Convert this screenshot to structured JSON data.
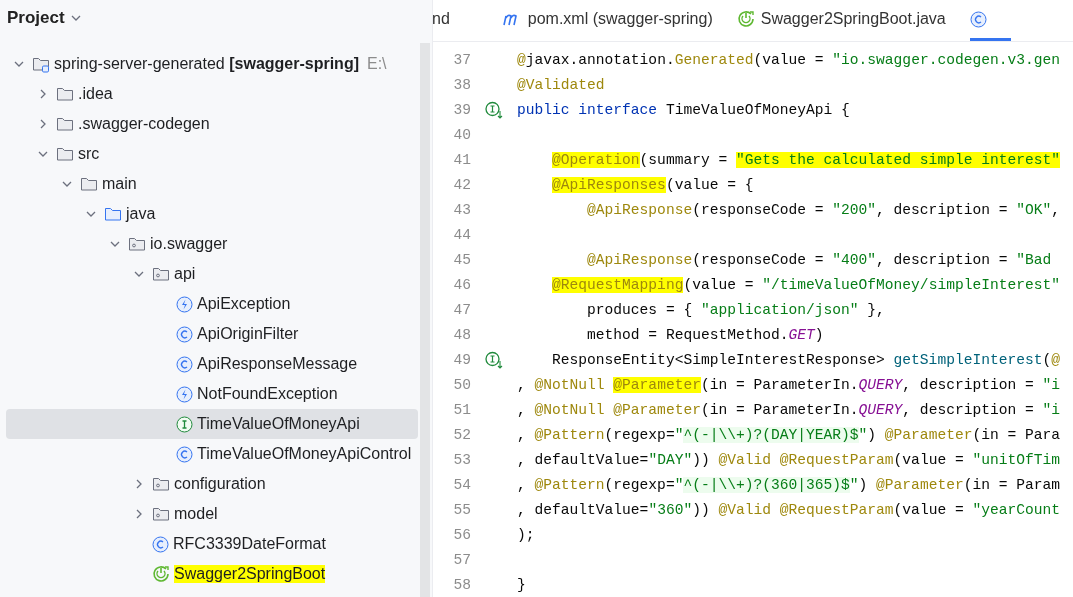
{
  "project_panel": {
    "title": "Project",
    "tree": [
      {
        "label": "spring-server-generated",
        "bold_suffix": "[swagger-spring]",
        "path": "E:\\",
        "kind": "module",
        "expanded": true,
        "selected": false,
        "highlighted": false,
        "children": [
          {
            "label": ".idea",
            "kind": "folder",
            "expanded": false,
            "selected": false,
            "highlighted": false
          },
          {
            "label": ".swagger-codegen",
            "kind": "folder",
            "expanded": false,
            "selected": false,
            "highlighted": false
          },
          {
            "label": "src",
            "kind": "folder",
            "expanded": true,
            "selected": false,
            "highlighted": false,
            "children": [
              {
                "label": "main",
                "kind": "folder",
                "expanded": true,
                "selected": false,
                "highlighted": false,
                "children": [
                  {
                    "label": "java",
                    "kind": "source",
                    "expanded": true,
                    "selected": false,
                    "highlighted": false,
                    "children": [
                      {
                        "label": "io.swagger",
                        "kind": "package",
                        "expanded": true,
                        "selected": false,
                        "highlighted": false,
                        "children": [
                          {
                            "label": "api",
                            "kind": "package",
                            "expanded": true,
                            "selected": false,
                            "highlighted": false,
                            "children": [
                              {
                                "label": "ApiException",
                                "kind": "exception",
                                "selected": false,
                                "highlighted": false
                              },
                              {
                                "label": "ApiOriginFilter",
                                "kind": "class",
                                "selected": false,
                                "highlighted": false
                              },
                              {
                                "label": "ApiResponseMessage",
                                "kind": "class",
                                "selected": false,
                                "highlighted": false
                              },
                              {
                                "label": "NotFoundException",
                                "kind": "exception",
                                "selected": false,
                                "highlighted": false
                              },
                              {
                                "label": "TimeValueOfMoneyApi",
                                "kind": "interface",
                                "selected": true,
                                "highlighted": false
                              },
                              {
                                "label": "TimeValueOfMoneyApiControl",
                                "kind": "class",
                                "selected": false,
                                "highlighted": false
                              }
                            ]
                          },
                          {
                            "label": "configuration",
                            "kind": "package",
                            "expanded": false,
                            "selected": false,
                            "highlighted": false
                          },
                          {
                            "label": "model",
                            "kind": "package",
                            "expanded": false,
                            "selected": false,
                            "highlighted": false
                          },
                          {
                            "label": "RFC3339DateFormat",
                            "kind": "class",
                            "selected": false,
                            "highlighted": false
                          },
                          {
                            "label": "Swagger2SpringBoot",
                            "kind": "springboot",
                            "selected": false,
                            "highlighted": true
                          }
                        ]
                      }
                    ]
                  }
                ]
              }
            ]
          }
        ]
      }
    ]
  },
  "editor": {
    "tabs": [
      {
        "label": "nd",
        "kind": "plain",
        "selected": false
      },
      {
        "label": "pom.xml (swagger-spring)",
        "kind": "maven",
        "selected": false
      },
      {
        "label": "Swagger2SpringBoot.java",
        "kind": "springboot",
        "selected": false
      },
      {
        "kind": "class",
        "selected": true
      }
    ],
    "lines": [
      {
        "number": "37",
        "kind": "plain",
        "tokens": [
          {
            "text": "@",
            "kind": "ann"
          },
          {
            "text": "javax.annotation.",
            "kind": "plain"
          },
          {
            "text": "Generated",
            "kind": "ann"
          },
          {
            "text": "(value = ",
            "kind": "plain"
          },
          {
            "text": "\"io.swagger.codegen.v3.gen",
            "kind": "str"
          }
        ]
      },
      {
        "number": "38",
        "kind": "plain",
        "tokens": [
          {
            "text": "@Validated",
            "kind": "ann"
          }
        ]
      },
      {
        "number": "39",
        "kind": "implements",
        "tokens": [
          {
            "text": "public",
            "kind": "kw"
          },
          {
            "text": " interface",
            "kind": "kw"
          },
          {
            "text": " TimeValueOfMoneyApi {",
            "kind": "plain"
          }
        ]
      },
      {
        "number": "40",
        "kind": "plain"
      },
      {
        "number": "41",
        "kind": "plain",
        "tokens": [
          {
            "text": "    @Operation",
            "kind": "ann_hl"
          },
          {
            "text": "(summary = ",
            "kind": "plain"
          },
          {
            "text": "\"Gets the calculated simple interest\"",
            "kind": "str_hl"
          }
        ]
      },
      {
        "number": "42",
        "kind": "plain",
        "tokens": [
          {
            "text": "    @ApiResponses",
            "kind": "ann_hl"
          },
          {
            "text": "(value = {",
            "kind": "plain"
          }
        ]
      },
      {
        "number": "43",
        "kind": "plain",
        "tokens": [
          {
            "text": "        @ApiResponse",
            "kind": "ann"
          },
          {
            "text": "(responseCode = ",
            "kind": "plain"
          },
          {
            "text": "\"200\"",
            "kind": "str"
          },
          {
            "text": ", description = ",
            "kind": "plain"
          },
          {
            "text": "\"OK\"",
            "kind": "str"
          },
          {
            "text": ",",
            "kind": "plain"
          }
        ]
      },
      {
        "number": "44",
        "kind": "plain"
      },
      {
        "number": "45",
        "kind": "plain",
        "tokens": [
          {
            "text": "        @ApiResponse",
            "kind": "ann"
          },
          {
            "text": "(responseCode = ",
            "kind": "plain"
          },
          {
            "text": "\"400\"",
            "kind": "str"
          },
          {
            "text": ", description = ",
            "kind": "plain"
          },
          {
            "text": "\"Bad",
            "kind": "str"
          }
        ]
      },
      {
        "number": "46",
        "kind": "plain",
        "tokens": [
          {
            "text": "    @RequestMapping",
            "kind": "ann_hl"
          },
          {
            "text": "(value = ",
            "kind": "plain"
          },
          {
            "text": "\"/timeValueOfMoney/simpleInterest\"",
            "kind": "str"
          }
        ]
      },
      {
        "number": "47",
        "kind": "plain",
        "tokens": [
          {
            "text": "        produces = { ",
            "kind": "plain"
          },
          {
            "text": "\"application/json\"",
            "kind": "str"
          },
          {
            "text": " },",
            "kind": "plain"
          }
        ]
      },
      {
        "number": "48",
        "kind": "plain",
        "tokens": [
          {
            "text": "        method = RequestMethod.",
            "kind": "plain"
          },
          {
            "text": "GET",
            "kind": "const"
          },
          {
            "text": ")",
            "kind": "plain"
          }
        ]
      },
      {
        "number": "49",
        "kind": "implements",
        "tokens": [
          {
            "text": "    ResponseEntity<SimpleInterestResponse> ",
            "kind": "plain"
          },
          {
            "text": "getSimpleInterest",
            "kind": "method"
          },
          {
            "text": "(",
            "kind": "plain"
          },
          {
            "text": "@",
            "kind": "ann"
          }
        ]
      },
      {
        "number": "50",
        "kind": "plain",
        "tokens": [
          {
            "text": ", ",
            "kind": "plain"
          },
          {
            "text": "@NotNull ",
            "kind": "ann"
          },
          {
            "text": "@Parameter",
            "kind": "ann_hl"
          },
          {
            "text": "(in = ParameterIn.",
            "kind": "plain"
          },
          {
            "text": "QUERY",
            "kind": "const"
          },
          {
            "text": ", description = ",
            "kind": "plain"
          },
          {
            "text": "\"i",
            "kind": "str"
          }
        ]
      },
      {
        "number": "51",
        "kind": "plain",
        "tokens": [
          {
            "text": ", ",
            "kind": "plain"
          },
          {
            "text": "@NotNull @Parameter",
            "kind": "ann"
          },
          {
            "text": "(in = ParameterIn.",
            "kind": "plain"
          },
          {
            "text": "QUERY",
            "kind": "const"
          },
          {
            "text": ", description = ",
            "kind": "plain"
          },
          {
            "text": "\"i",
            "kind": "str"
          }
        ]
      },
      {
        "number": "52",
        "kind": "plain",
        "tokens": [
          {
            "text": ", ",
            "kind": "plain"
          },
          {
            "text": "@Pattern",
            "kind": "ann"
          },
          {
            "text": "(regexp=",
            "kind": "plain"
          },
          {
            "text": "\"",
            "kind": "str"
          },
          {
            "text": "^(-|\\\\+)?(DAY|YEAR)$",
            "kind": "regex"
          },
          {
            "text": "\"",
            "kind": "str"
          },
          {
            "text": ") ",
            "kind": "plain"
          },
          {
            "text": "@Parameter",
            "kind": "ann"
          },
          {
            "text": "(in = Para",
            "kind": "plain"
          }
        ]
      },
      {
        "number": "53",
        "kind": "plain",
        "tokens": [
          {
            "text": ", defaultValue=",
            "kind": "plain"
          },
          {
            "text": "\"DAY\"",
            "kind": "str"
          },
          {
            "text": ")) ",
            "kind": "plain"
          },
          {
            "text": "@Valid @RequestParam",
            "kind": "ann"
          },
          {
            "text": "(value = ",
            "kind": "plain"
          },
          {
            "text": "\"unitOfTim",
            "kind": "str"
          }
        ]
      },
      {
        "number": "54",
        "kind": "plain",
        "tokens": [
          {
            "text": ", ",
            "kind": "plain"
          },
          {
            "text": "@Pattern",
            "kind": "ann"
          },
          {
            "text": "(regexp=",
            "kind": "plain"
          },
          {
            "text": "\"",
            "kind": "str"
          },
          {
            "text": "^(-|\\\\+)?(360|365)$",
            "kind": "regex"
          },
          {
            "text": "\"",
            "kind": "str"
          },
          {
            "text": ") ",
            "kind": "plain"
          },
          {
            "text": "@Parameter",
            "kind": "ann"
          },
          {
            "text": "(in = Param",
            "kind": "plain"
          }
        ]
      },
      {
        "number": "55",
        "kind": "plain",
        "tokens": [
          {
            "text": ", defaultValue=",
            "kind": "plain"
          },
          {
            "text": "\"360\"",
            "kind": "str"
          },
          {
            "text": ")) ",
            "kind": "plain"
          },
          {
            "text": "@Valid @RequestParam",
            "kind": "ann"
          },
          {
            "text": "(value = ",
            "kind": "plain"
          },
          {
            "text": "\"yearCount",
            "kind": "str"
          }
        ]
      },
      {
        "number": "56",
        "kind": "plain",
        "tokens": [
          {
            "text": ");",
            "kind": "plain"
          }
        ]
      },
      {
        "number": "57",
        "kind": "plain"
      },
      {
        "number": "58",
        "kind": "plain",
        "tokens": [
          {
            "text": "}",
            "kind": "plain"
          }
        ]
      }
    ]
  }
}
